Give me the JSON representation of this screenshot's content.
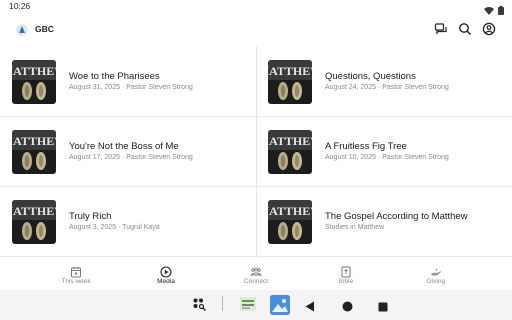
{
  "status": {
    "time": "10:26"
  },
  "app": {
    "title": "GBC"
  },
  "sermons": [
    {
      "title": "Woe to the Pharisees",
      "subtitle": "August 31, 2025 · Pastor Steven Strong"
    },
    {
      "title": "Questions, Questions",
      "subtitle": "August 24, 2025 · Pastor Steven Strong"
    },
    {
      "title": "You're Not the Boss of Me",
      "subtitle": "August 17, 2025 · Pastor Steven Strong"
    },
    {
      "title": "A Fruitless Fig Tree",
      "subtitle": "August 10, 2025 · Pastor Steven Strong"
    },
    {
      "title": "Truly Rich",
      "subtitle": "August 3, 2025 · Tugrul Kaya"
    },
    {
      "title": "The Gospel According to Matthew",
      "subtitle": "Studies in Matthew"
    }
  ],
  "thumbnail_text": "MATTHEW",
  "tabs": [
    {
      "label": "This week",
      "icon": "calendar-icon"
    },
    {
      "label": "Media",
      "icon": "play-circle-icon"
    },
    {
      "label": "Connect",
      "icon": "people-icon"
    },
    {
      "label": "Bible",
      "icon": "bible-icon"
    },
    {
      "label": "Giving",
      "icon": "giving-hand-icon"
    }
  ],
  "active_tab": "Media",
  "colors": {
    "accent": "#222222",
    "muted": "#8a8a8a",
    "thumb_bg": "#1c1c1c"
  }
}
